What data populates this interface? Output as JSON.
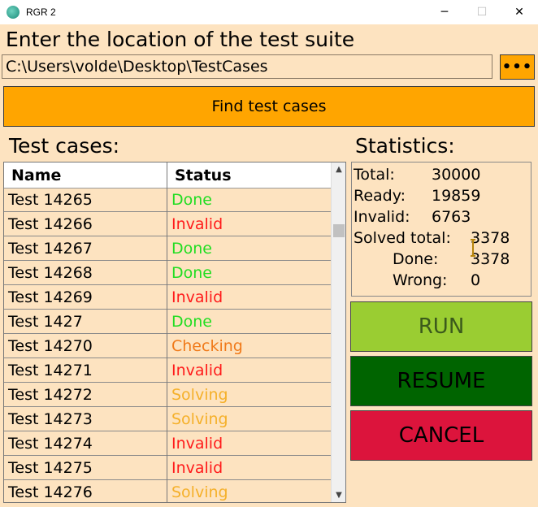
{
  "window": {
    "title": "RGR 2",
    "minimize_icon": "─",
    "maximize_icon": "☐",
    "close_icon": "✕"
  },
  "header": {
    "prompt": "Enter the location of the test suite"
  },
  "path": {
    "value": "C:\\Users\\volde\\Desktop\\TestCases",
    "browse_label": "•••"
  },
  "find_button": {
    "label": "Find test cases"
  },
  "test_cases": {
    "title": "Test cases:",
    "columns": {
      "name": "Name",
      "status": "Status"
    },
    "rows": [
      {
        "name": "Test 14265",
        "status": "Done",
        "color": "#22dd22"
      },
      {
        "name": "Test 14266",
        "status": "Invalid",
        "color": "#ff1a1a"
      },
      {
        "name": "Test 14267",
        "status": "Done",
        "color": "#22dd22"
      },
      {
        "name": "Test 14268",
        "status": "Done",
        "color": "#22dd22"
      },
      {
        "name": "Test 14269",
        "status": "Invalid",
        "color": "#ff1a1a"
      },
      {
        "name": "Test 1427",
        "status": "Done",
        "color": "#22dd22"
      },
      {
        "name": "Test 14270",
        "status": "Checking",
        "color": "#f07a1a"
      },
      {
        "name": "Test 14271",
        "status": "Invalid",
        "color": "#ff1a1a"
      },
      {
        "name": "Test 14272",
        "status": "Solving",
        "color": "#f5b02a"
      },
      {
        "name": "Test 14273",
        "status": "Solving",
        "color": "#f5b02a"
      },
      {
        "name": "Test 14274",
        "status": "Invalid",
        "color": "#ff1a1a"
      },
      {
        "name": "Test 14275",
        "status": "Invalid",
        "color": "#ff1a1a"
      },
      {
        "name": "Test 14276",
        "status": "Solving",
        "color": "#f5b02a"
      }
    ]
  },
  "statistics": {
    "title": "Statistics:",
    "total_label": "Total:",
    "total_value": "30000",
    "ready_label": "Ready:",
    "ready_value": "19859",
    "invalid_label": "Invalid:",
    "invalid_value": "6763",
    "solved_label": "Solved total:",
    "solved_value": "3378",
    "done_label": "Done:",
    "done_value": "3378",
    "wrong_label": "Wrong:",
    "wrong_value": "0"
  },
  "actions": {
    "run": "RUN",
    "resume": "RESUME",
    "cancel": "CANCEL"
  },
  "colors": {
    "background": "#fde3c0",
    "accent": "#ffa500",
    "run": "#9acd32",
    "resume": "#006400",
    "cancel": "#dc143c"
  }
}
